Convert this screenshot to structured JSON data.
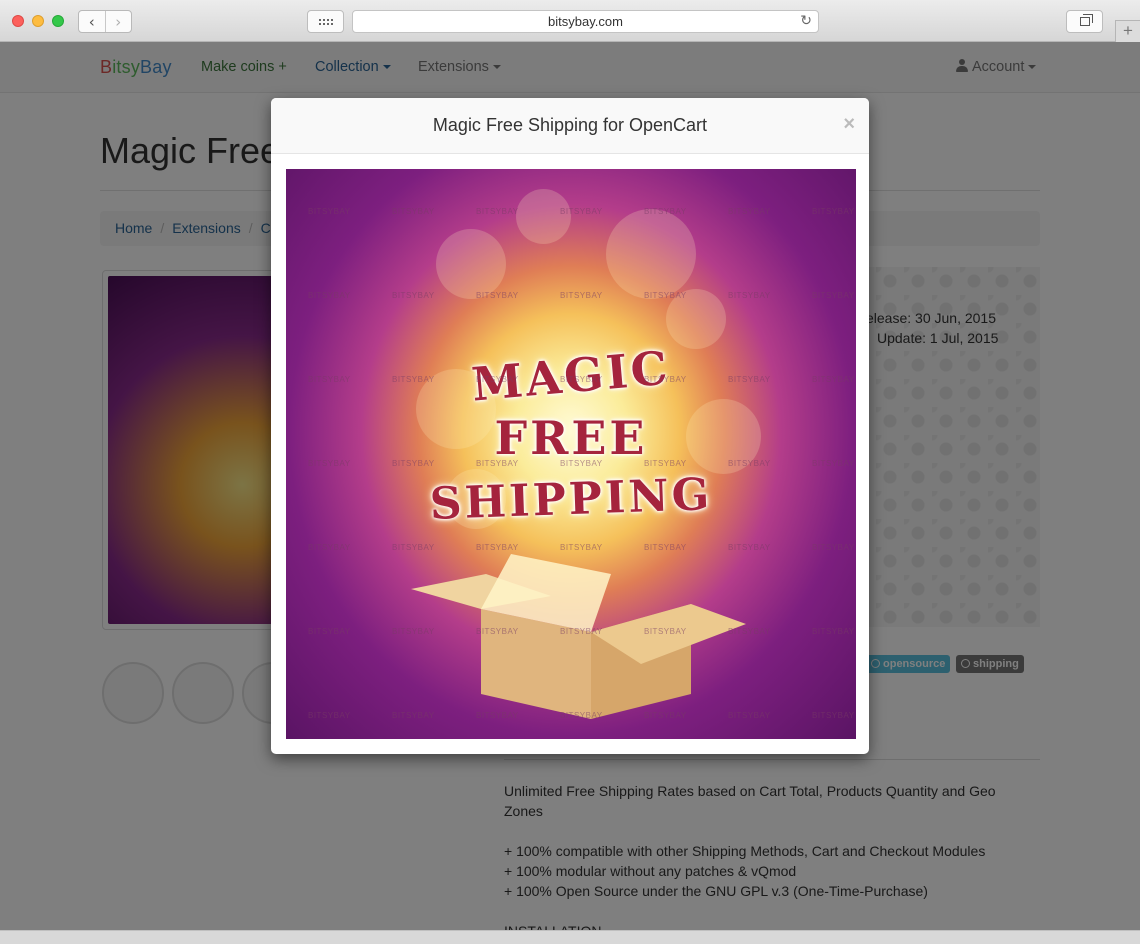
{
  "browser": {
    "url": "bitsybay.com"
  },
  "navbar": {
    "brand_b": "B",
    "brand_itsy": "itsy",
    "brand_bay": "Bay",
    "make_coins": "Make coins +",
    "collection": "Collection",
    "extensions": "Extensions",
    "account": "Account"
  },
  "page": {
    "title_partial": "Magic Free",
    "breadcrumb": {
      "home": "Home",
      "extensions": "Extensions",
      "category_partial": "C"
    },
    "release": "elease: 30 Jun, 2015",
    "update": "Update: 1 Jul, 2015",
    "tags": [
      "opensource",
      "shipping"
    ],
    "description": {
      "summary": "Unlimited Free Shipping Rates based on Cart Total, Products Quantity and Geo Zones",
      "feature1": "+ 100% compatible with other Shipping Methods, Cart and Checkout Modules",
      "feature2": "+ 100% modular without any patches & vQmod",
      "feature3": "+ 100% Open Source under the GNU GPL v.3 (One-Time-Purchase)",
      "installation": "INSTALLATION"
    }
  },
  "modal": {
    "title": "Magic Free Shipping for OpenCart",
    "close": "×",
    "image_text": {
      "line1": "MAGIC",
      "line2": "FREE",
      "line3": "SHIPPING"
    },
    "watermark": "BITSYBAY"
  },
  "colors": {
    "brand_red": "#d9534f",
    "brand_green": "#5cb85c",
    "brand_blue": "#428bca",
    "tag_opensource": "#5bc0de",
    "tag_shipping": "#777777"
  }
}
